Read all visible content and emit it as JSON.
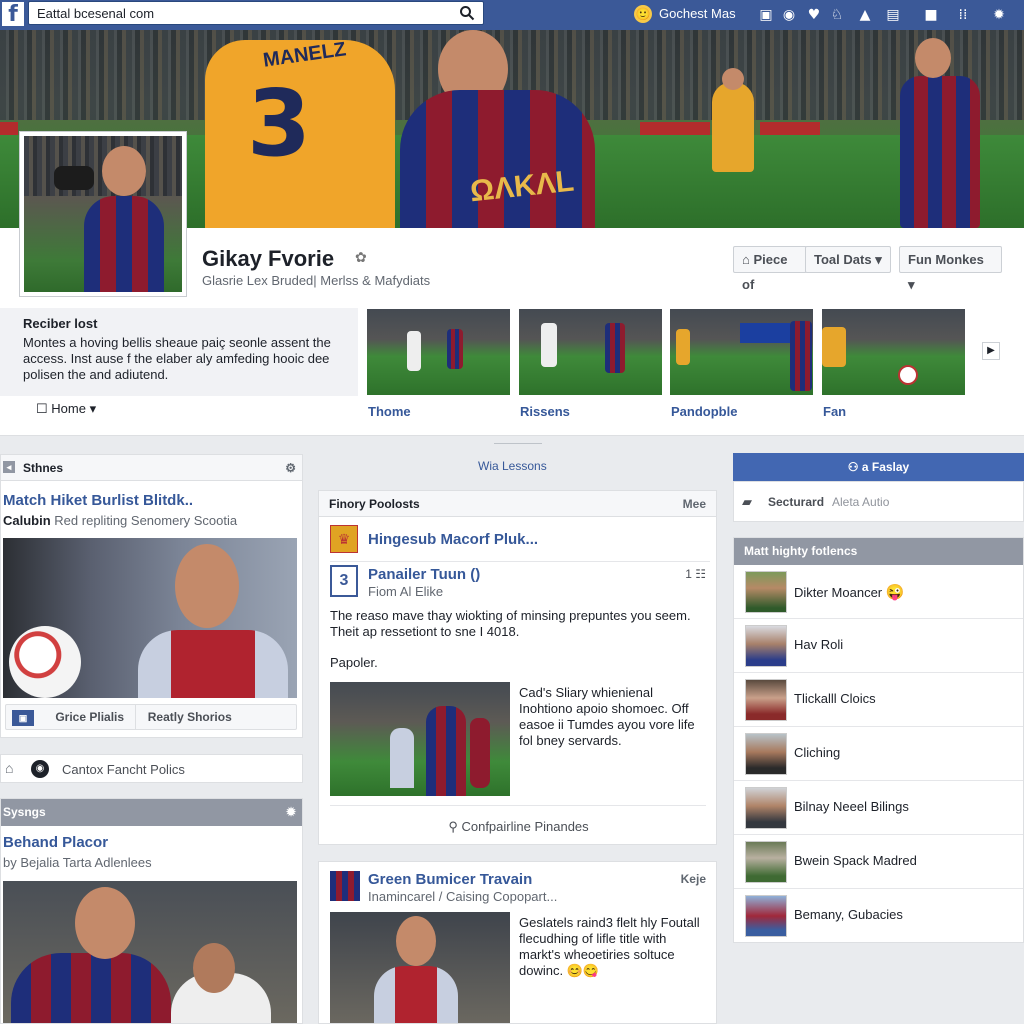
{
  "topbar": {
    "logo": "f",
    "search_value": "Eattal bcesenal com",
    "user_name": "Gochest Mas",
    "icons": [
      "camera-icon",
      "messenger-icon",
      "heart-icon",
      "bell-icon",
      "triangle-icon",
      "video-icon",
      "chat-icon",
      "grid-icon",
      "settings-icon"
    ]
  },
  "cover": {
    "jersey_name": "MANELZ",
    "jersey_number": "3",
    "sponsor": "ΩΛKΛL"
  },
  "profile": {
    "name": "Gikay Fvorie",
    "subtitle": "Glasrie Lex Bruded| Merlss & Mafydiats",
    "buttons": {
      "piece": "Piece of",
      "toal": "Toal Dats",
      "fun": "Fun Monkes"
    }
  },
  "about": {
    "title": "Reciber lost",
    "body": "Montes a hoving bellis sheaue paiç seonle assent the access. Inst ause f the elaber aly amfeding hooic dee polisen the and adiutend."
  },
  "thumbs": [
    {
      "label": "Thome"
    },
    {
      "label": "Rissens"
    },
    {
      "label": "Pandopble"
    },
    {
      "label": "Fan"
    }
  ],
  "home_link": "Home",
  "left": {
    "shares_title": "Sthnes",
    "post1": {
      "title": "Match Hiket Burlist Blitdk..",
      "byline_bold": "Calubin",
      "byline": "Red repliting Senomery Scootia",
      "btn1": "Grice Plialis",
      "btn2": "Reatly Shorios"
    },
    "policy_text": "Cantox Fancht Polics",
    "settings_title": "Sysngs",
    "post2": {
      "title": "Behand Placor",
      "byline": "by Bejalia Tarta Adlenlees"
    }
  },
  "center": {
    "lessons": "Wia Lessons",
    "feed_title": "Finory Poolosts",
    "feed_more": "Mee",
    "item1_title": "Hingesub Macorf Pluk...",
    "item2_title": "Panailer Tuun ()",
    "item2_sub": "Fiom Al Elike",
    "item2_count": "1",
    "body1": "The reaso mave thay wiokting of minsing prepuntes you seem. Theit ap ressetiont to sne I 4018.",
    "body2": "Papoler.",
    "side_text": "Cad's Sliary whienienal Inohtiono apoio shomoec. Off easoe ii Tumdes ayou vore life fol bney servards.",
    "footer": "Confpairline Pinandes",
    "post2_title": "Green Bumicer Travain",
    "post2_sub": "Inamincarel / Caising Copopart...",
    "post2_tag": "Keje",
    "post2_text": "Geslatels raind3 flelt hly Foutall flecudhing of lifle title with markt's wheoetiries soltuce dowinc. 😊😋"
  },
  "right": {
    "fasy_btn": "a Faslay",
    "search_bold": "Secturard",
    "search_muted": "Aleta Autio",
    "friends_title": "Matt highty fotlencs",
    "friends": [
      {
        "name": "Dikter Moancer",
        "emoji": "😜"
      },
      {
        "name": "Hav Roli",
        "emoji": ""
      },
      {
        "name": "Tlickalll Cloics",
        "emoji": ""
      },
      {
        "name": "Cliching",
        "emoji": ""
      },
      {
        "name": "Bilnay Neeel Bilings",
        "emoji": ""
      },
      {
        "name": "Bwein Spack Madred",
        "emoji": ""
      },
      {
        "name": "Bemany, Gubacies",
        "emoji": ""
      }
    ]
  },
  "colors": {
    "brand": "#3b5998",
    "link": "#365899",
    "page_bg": "#e9ebee"
  }
}
